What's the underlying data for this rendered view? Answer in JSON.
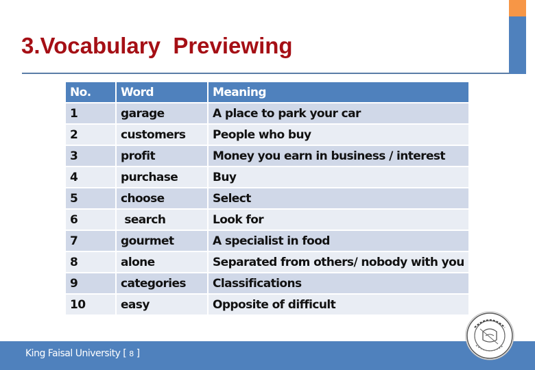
{
  "slide": {
    "title": "3.Vocabulary  Previewing",
    "accent_colors": {
      "title": "#a50f15",
      "primary": "#4f81bd",
      "secondary": "#f79646"
    }
  },
  "table": {
    "headers": [
      "No.",
      "Word",
      "Meaning"
    ],
    "rows": [
      {
        "no": "1",
        "word": "garage",
        "meaning": "A place to park your car"
      },
      {
        "no": "2",
        "word": "customers",
        "meaning": "People who buy"
      },
      {
        "no": "3",
        "word": "profit",
        "meaning": "Money you earn in business / interest"
      },
      {
        "no": "4",
        "word": "purchase",
        "meaning": "Buy"
      },
      {
        "no": "5",
        "word": "choose",
        "meaning": "Select"
      },
      {
        "no": "6",
        "word": " search",
        "meaning": "Look for"
      },
      {
        "no": "7",
        "word": "gourmet",
        "meaning": "A specialist in food"
      },
      {
        "no": "8",
        "word": "alone",
        "meaning": "Separated from others/ nobody with you"
      },
      {
        "no": "9",
        "word": "categories",
        "meaning": "Classifications"
      },
      {
        "no": "10",
        "word": "easy",
        "meaning": "Opposite of difficult"
      }
    ]
  },
  "footer": {
    "institution": "King Faisal University [ ",
    "page_number": "8",
    "close_bracket": " ]",
    "logo": "university-seal-icon"
  }
}
